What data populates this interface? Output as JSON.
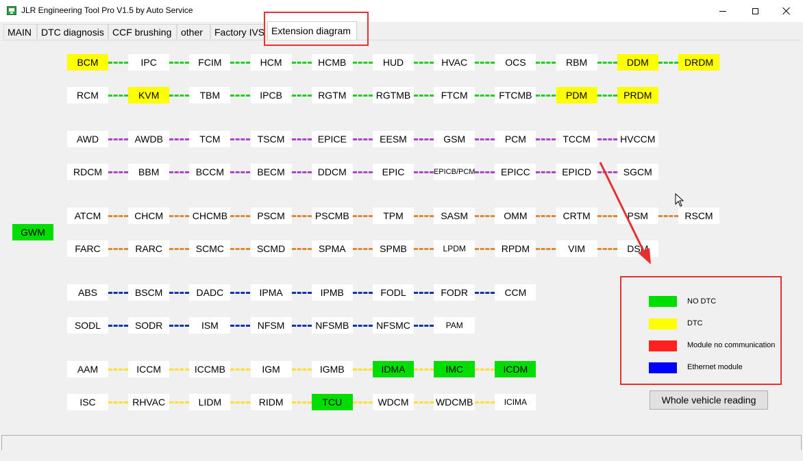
{
  "window": {
    "title": "JLR Engineering Tool Pro V1.5 by Auto Service"
  },
  "tabs": [
    {
      "label": "MAIN"
    },
    {
      "label": "DTC diagnosis"
    },
    {
      "label": "CCF brushing"
    },
    {
      "label": "other"
    },
    {
      "label": "Factory IVS"
    },
    {
      "label": "Extension diagram"
    }
  ],
  "active_tab": "Extension diagram",
  "gateway": {
    "label": "GWM",
    "status": "NO DTC"
  },
  "colors": {
    "no_dtc": "#00dd00",
    "dtc": "#ffff00",
    "no_communication": "#ff2020",
    "ethernet": "#0000ff",
    "bus_green": "#22cc22",
    "bus_purple": "#aa44cc",
    "bus_orange": "#dd8833",
    "bus_blue": "#1133aa",
    "bus_yellow": "#ffdd33",
    "annotation_red": "#e53030"
  },
  "rows": [
    {
      "bus": "green",
      "modules": [
        {
          "label": "BCM",
          "status": "DTC"
        },
        {
          "label": "IPC",
          "status": ""
        },
        {
          "label": "FCIM",
          "status": ""
        },
        {
          "label": "HCM",
          "status": ""
        },
        {
          "label": "HCMB",
          "status": ""
        },
        {
          "label": "HUD",
          "status": ""
        },
        {
          "label": "HVAC",
          "status": ""
        },
        {
          "label": "OCS",
          "status": ""
        },
        {
          "label": "RBM",
          "status": ""
        },
        {
          "label": "DDM",
          "status": "DTC"
        },
        {
          "label": "DRDM",
          "status": "DTC"
        }
      ]
    },
    {
      "bus": "green",
      "modules": [
        {
          "label": "RCM",
          "status": ""
        },
        {
          "label": "KVM",
          "status": "DTC"
        },
        {
          "label": "TBM",
          "status": ""
        },
        {
          "label": "IPCB",
          "status": ""
        },
        {
          "label": "RGTM",
          "status": ""
        },
        {
          "label": "RGTMB",
          "status": ""
        },
        {
          "label": "FTCM",
          "status": ""
        },
        {
          "label": "FTCMB",
          "status": ""
        },
        {
          "label": "PDM",
          "status": "DTC"
        },
        {
          "label": "PRDM",
          "status": "DTC"
        }
      ]
    },
    {
      "bus": "purple",
      "modules": [
        {
          "label": "AWD",
          "status": ""
        },
        {
          "label": "AWDB",
          "status": ""
        },
        {
          "label": "TCM",
          "status": ""
        },
        {
          "label": "TSCM",
          "status": ""
        },
        {
          "label": "EPICE",
          "status": ""
        },
        {
          "label": "EESM",
          "status": ""
        },
        {
          "label": "GSM",
          "status": ""
        },
        {
          "label": "PCM",
          "status": ""
        },
        {
          "label": "TCCM",
          "status": ""
        },
        {
          "label": "HVCCM",
          "status": ""
        }
      ]
    },
    {
      "bus": "purple",
      "modules": [
        {
          "label": "RDCM",
          "status": ""
        },
        {
          "label": "BBM",
          "status": ""
        },
        {
          "label": "BCCM",
          "status": ""
        },
        {
          "label": "BECM",
          "status": ""
        },
        {
          "label": "DDCM",
          "status": ""
        },
        {
          "label": "EPIC",
          "status": ""
        },
        {
          "label": "EPICB/PCM",
          "status": ""
        },
        {
          "label": "EPICC",
          "status": ""
        },
        {
          "label": "EPICD",
          "status": ""
        },
        {
          "label": "SGCM",
          "status": ""
        }
      ]
    },
    {
      "bus": "orange",
      "modules": [
        {
          "label": "ATCM",
          "status": ""
        },
        {
          "label": "CHCM",
          "status": ""
        },
        {
          "label": "CHCMB",
          "status": ""
        },
        {
          "label": "PSCM",
          "status": ""
        },
        {
          "label": "PSCMB",
          "status": ""
        },
        {
          "label": "TPM",
          "status": ""
        },
        {
          "label": "SASM",
          "status": ""
        },
        {
          "label": "OMM",
          "status": ""
        },
        {
          "label": "CRTM",
          "status": ""
        },
        {
          "label": "PSM",
          "status": ""
        },
        {
          "label": "RSCM",
          "status": ""
        }
      ]
    },
    {
      "bus": "orange",
      "modules": [
        {
          "label": "FARC",
          "status": ""
        },
        {
          "label": "RARC",
          "status": ""
        },
        {
          "label": "SCMC",
          "status": ""
        },
        {
          "label": "SCMD",
          "status": ""
        },
        {
          "label": "SPMA",
          "status": ""
        },
        {
          "label": "SPMB",
          "status": ""
        },
        {
          "label": "LPDM",
          "status": ""
        },
        {
          "label": "RPDM",
          "status": ""
        },
        {
          "label": "VIM",
          "status": ""
        },
        {
          "label": "DSM",
          "status": ""
        }
      ]
    },
    {
      "bus": "blue",
      "modules": [
        {
          "label": "ABS",
          "status": ""
        },
        {
          "label": "BSCM",
          "status": ""
        },
        {
          "label": "DADC",
          "status": ""
        },
        {
          "label": "IPMA",
          "status": ""
        },
        {
          "label": "IPMB",
          "status": ""
        },
        {
          "label": "FODL",
          "status": ""
        },
        {
          "label": "FODR",
          "status": ""
        },
        {
          "label": "CCM",
          "status": ""
        }
      ]
    },
    {
      "bus": "blue",
      "modules": [
        {
          "label": "SODL",
          "status": ""
        },
        {
          "label": "SODR",
          "status": ""
        },
        {
          "label": "ISM",
          "status": ""
        },
        {
          "label": "NFSM",
          "status": ""
        },
        {
          "label": "NFSMB",
          "status": ""
        },
        {
          "label": "NFSMC",
          "status": ""
        },
        {
          "label": "PAM",
          "status": ""
        }
      ]
    },
    {
      "bus": "yellow",
      "modules": [
        {
          "label": "AAM",
          "status": ""
        },
        {
          "label": "ICCM",
          "status": ""
        },
        {
          "label": "ICCMB",
          "status": ""
        },
        {
          "label": "IGM",
          "status": ""
        },
        {
          "label": "IGMB",
          "status": ""
        },
        {
          "label": "IDMA",
          "status": "NO DTC"
        },
        {
          "label": "IMC",
          "status": "NO DTC"
        },
        {
          "label": "ICDM",
          "status": "NO DTC"
        }
      ]
    },
    {
      "bus": "yellow",
      "modules": [
        {
          "label": "ISC",
          "status": ""
        },
        {
          "label": "RHVAC",
          "status": ""
        },
        {
          "label": "LIDM",
          "status": ""
        },
        {
          "label": "RIDM",
          "status": ""
        },
        {
          "label": "TCU",
          "status": "NO DTC"
        },
        {
          "label": "WDCM",
          "status": ""
        },
        {
          "label": "WDCMB",
          "status": ""
        },
        {
          "label": "ICIMA",
          "status": ""
        }
      ]
    }
  ],
  "legend": {
    "items": [
      {
        "label": "NO DTC",
        "color": "#00dd00"
      },
      {
        "label": "DTC",
        "color": "#ffff00"
      },
      {
        "label": "Module no communication",
        "color": "#ff2020"
      },
      {
        "label": "Ethernet module",
        "color": "#0000ff"
      }
    ]
  },
  "whole_vehicle_button": "Whole vehicle reading"
}
